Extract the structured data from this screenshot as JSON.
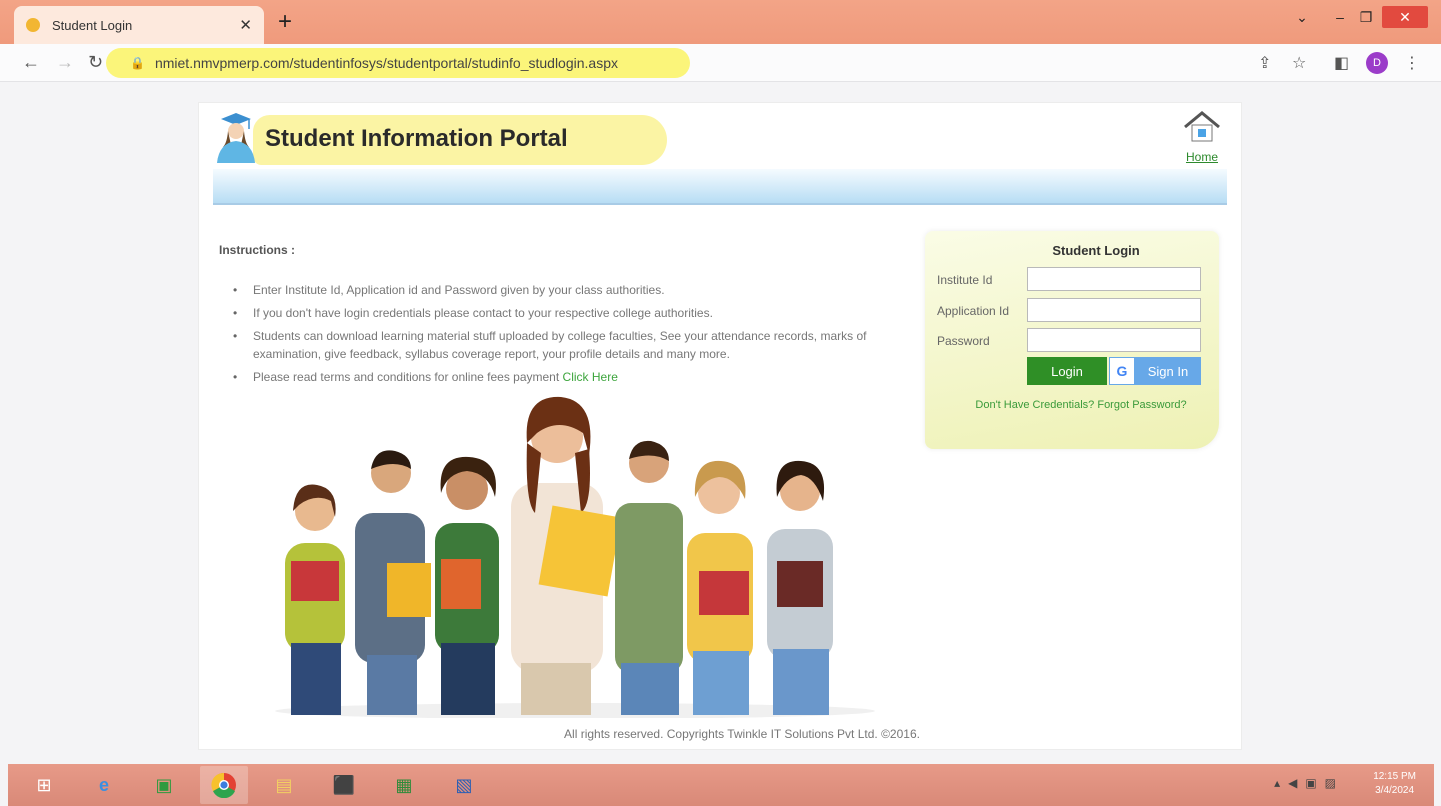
{
  "browser": {
    "tab_title": "Student Login",
    "url": "nmiet.nmvpmerp.com/studentinfosys/studentportal/studinfo_studlogin.aspx",
    "profile_initial": "D"
  },
  "header": {
    "title": "Student Information Portal",
    "home_label": "Home"
  },
  "instructions": {
    "heading": "Instructions :",
    "items": [
      "Enter Institute Id, Application id and Password given by your class authorities.",
      "If you don't have login credentials please contact to your respective college authorities.",
      "Students can download learning material stuff uploaded by college faculties, See your attendance records, marks of examination, give feedback, syllabus coverage report, your profile details and many more.",
      "Please read terms and conditions for online fees payment"
    ],
    "fees_link": "Click Here"
  },
  "login": {
    "heading": "Student Login",
    "institute_label": "Institute Id",
    "application_label": "Application Id",
    "password_label": "Password",
    "institute_value": "",
    "application_value": "",
    "password_value": "",
    "login_button": "Login",
    "google_button": "Sign In",
    "google_glyph": "G",
    "no_credentials_link": "Don't Have Credentials?",
    "forgot_password_link": "Forgot Password?"
  },
  "footer": {
    "copyright": "All rights reserved. Copyrights Twinkle IT Solutions Pvt Ltd. ©2016."
  },
  "taskbar": {
    "time": "12:15 PM",
    "date": "3/4/2024"
  },
  "colors": {
    "login_green": "#2f8f26",
    "google_blue": "#67a8e8",
    "link_green": "#3da53d",
    "highlight_yellow": "#fbf39a"
  }
}
